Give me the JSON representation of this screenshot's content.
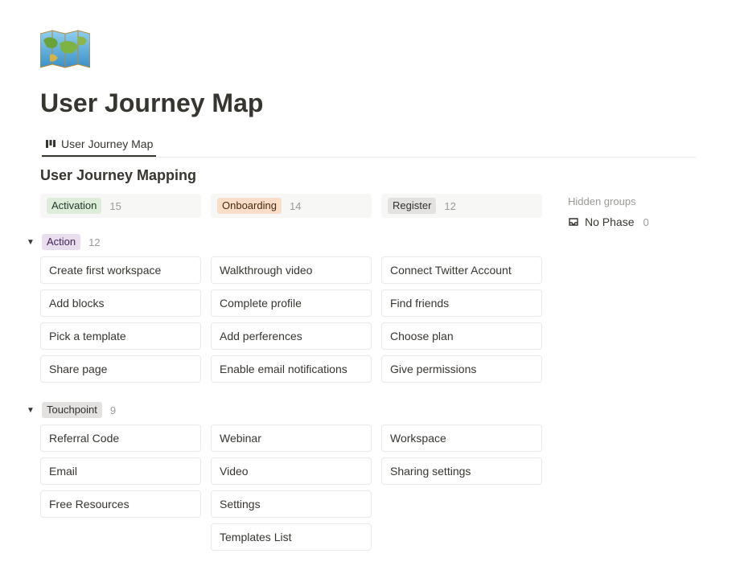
{
  "page_title": "User Journey Map",
  "tab": {
    "label": "User Journey Map"
  },
  "section_title": "User Journey Mapping",
  "columns": [
    {
      "key": "activation",
      "label": "Activation",
      "count": "15",
      "pill_class": "pill-green"
    },
    {
      "key": "onboarding",
      "label": "Onboarding",
      "count": "14",
      "pill_class": "pill-peach"
    },
    {
      "key": "register",
      "label": "Register",
      "count": "12",
      "pill_class": "pill-gray"
    }
  ],
  "groups": [
    {
      "key": "action",
      "label": "Action",
      "count": "12",
      "pill_class": "pill-purple",
      "rows": {
        "activation": [
          "Create first workspace",
          "Add blocks",
          "Pick a template",
          "Share page"
        ],
        "onboarding": [
          "Walkthrough video",
          "Complete profile",
          "Add perferences",
          "Enable email notifications"
        ],
        "register": [
          "Connect Twitter Account",
          "Find friends",
          "Choose plan",
          "Give permissions"
        ]
      }
    },
    {
      "key": "touchpoint",
      "label": "Touchpoint",
      "count": "9",
      "pill_class": "pill-gray",
      "rows": {
        "activation": [
          "Referral Code",
          "Email",
          "Free Resources"
        ],
        "onboarding": [
          "Webinar",
          "Video",
          "Settings",
          "Templates List"
        ],
        "register": [
          "Workspace",
          "Sharing settings"
        ]
      }
    }
  ],
  "hidden": {
    "title": "Hidden groups",
    "item_label": "No Phase",
    "item_count": "0"
  }
}
